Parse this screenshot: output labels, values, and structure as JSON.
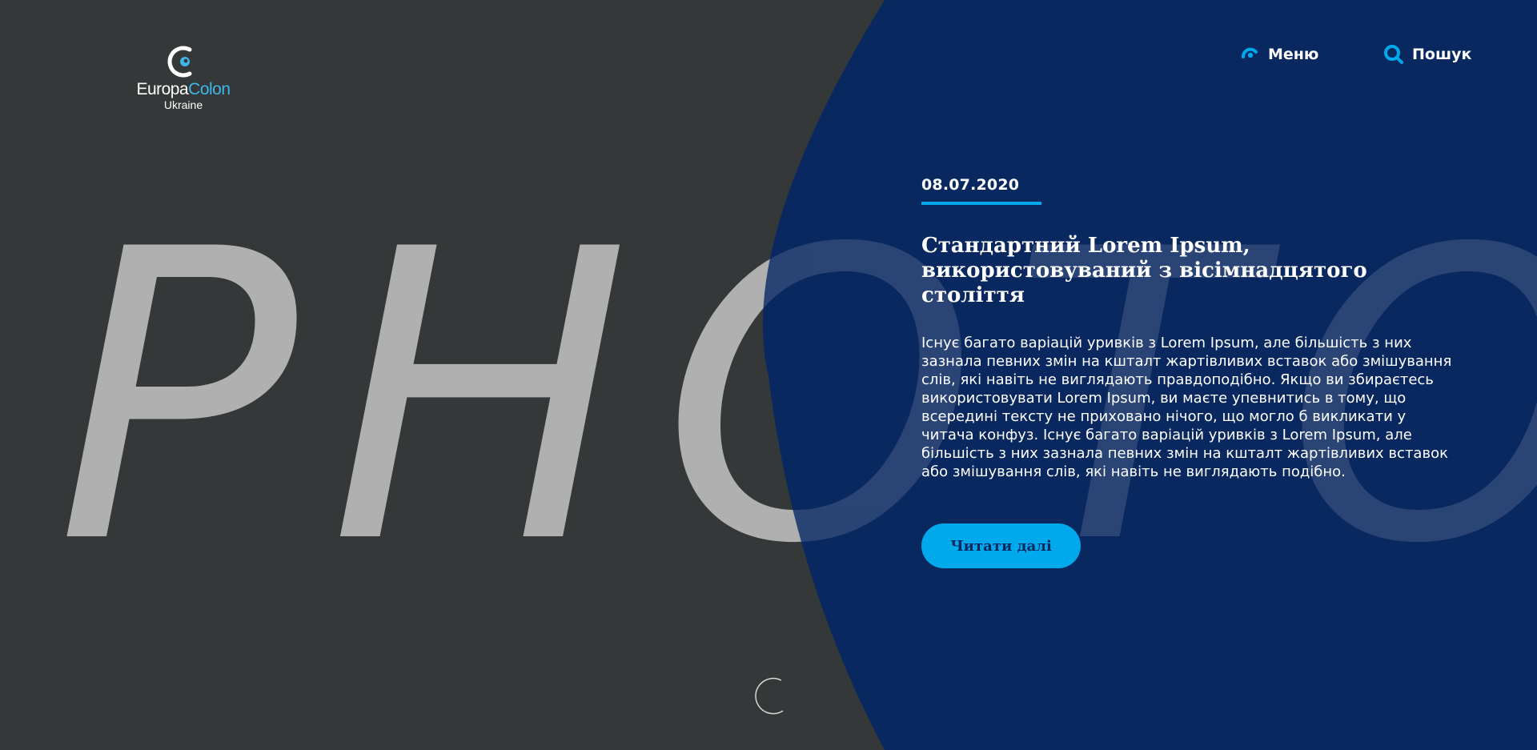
{
  "brand": {
    "name_part1": "Europa",
    "name_part2": "Colon",
    "subtitle": "Ukraine",
    "accent_color": "#3fb6ea"
  },
  "nav": {
    "menu_label": "Меню",
    "menu_icon": "menu-swirl-icon",
    "search_label": "Пошук",
    "search_icon": "search-icon"
  },
  "hero": {
    "placeholder_word": "PHOTO",
    "date": "08.07.2020",
    "title": "Стандартний Lorem Ipsum, використовуваний з вісімнадцятого століття",
    "body": "Існує багато варіацій уривків з Lorem Ipsum, але більшість з них зазнала певних змін на кшталт жартівливих вставок або змішування слів, які навіть не виглядають правдоподібно. Якщо ви збираєтесь використовувати Lorem Ipsum, ви маєте упевнитись в тому, що всередині тексту не приховано нічого, що могло б викликати у читача конфуз. Існує багато варіацій уривків з Lorem Ipsum, але більшість з них зазнала певних змін на кшталт жартівливих вставок або змішування слів, які навіть не виглядають подібно.",
    "cta_label": "Читати далі"
  },
  "colors": {
    "background_dark": "#353839",
    "panel_blue": "#0a2860",
    "accent_blue": "#00a8ec",
    "placeholder_text": "#b0b0b0"
  },
  "loader_icon": "loading-spinner-icon"
}
